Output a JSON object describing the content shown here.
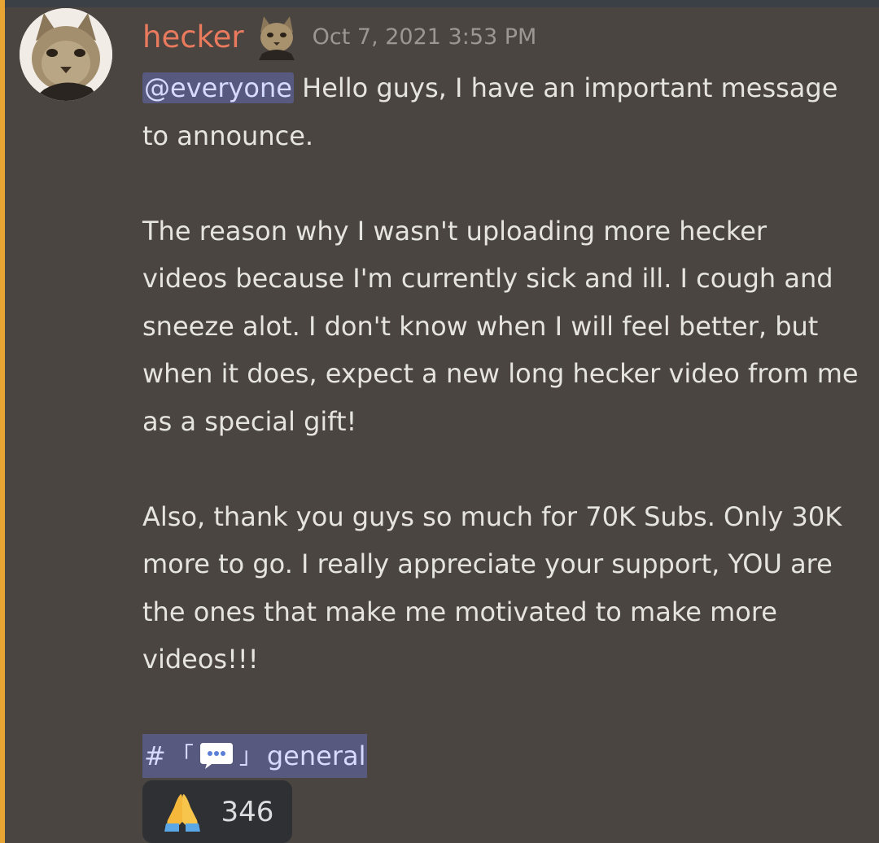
{
  "message": {
    "author": "hecker",
    "timestamp": "Oct 7, 2021 3:53 PM",
    "mention": "@everyone",
    "line1_rest": " Hello guys, I have an important message to announce.",
    "paragraph2": "The reason why I wasn't uploading more hecker videos because I'm currently sick and ill. I cough and sneeze alot. I don't know when I will feel better, but when it does, expect a new long hecker video from me as a special gift!",
    "paragraph3": "Also, thank you guys so much for 70K Subs. Only 30K more to go. I really appreciate your support, YOU are the ones that make me motivated to make more videos!!!",
    "channel": {
      "hash": "#",
      "open_bracket": "「",
      "close_bracket": "」",
      "name": "general",
      "icon": "speech-bubble-icon"
    }
  },
  "reaction": {
    "emoji": "folded-hands-icon",
    "count": "346"
  },
  "colors": {
    "background": "#4a4540",
    "mention_bar": "#e8a534",
    "username": "#e97a5e",
    "timestamp": "#9b9792",
    "mention_bg": "#6a70cc",
    "reaction_bg": "#2f3034"
  }
}
